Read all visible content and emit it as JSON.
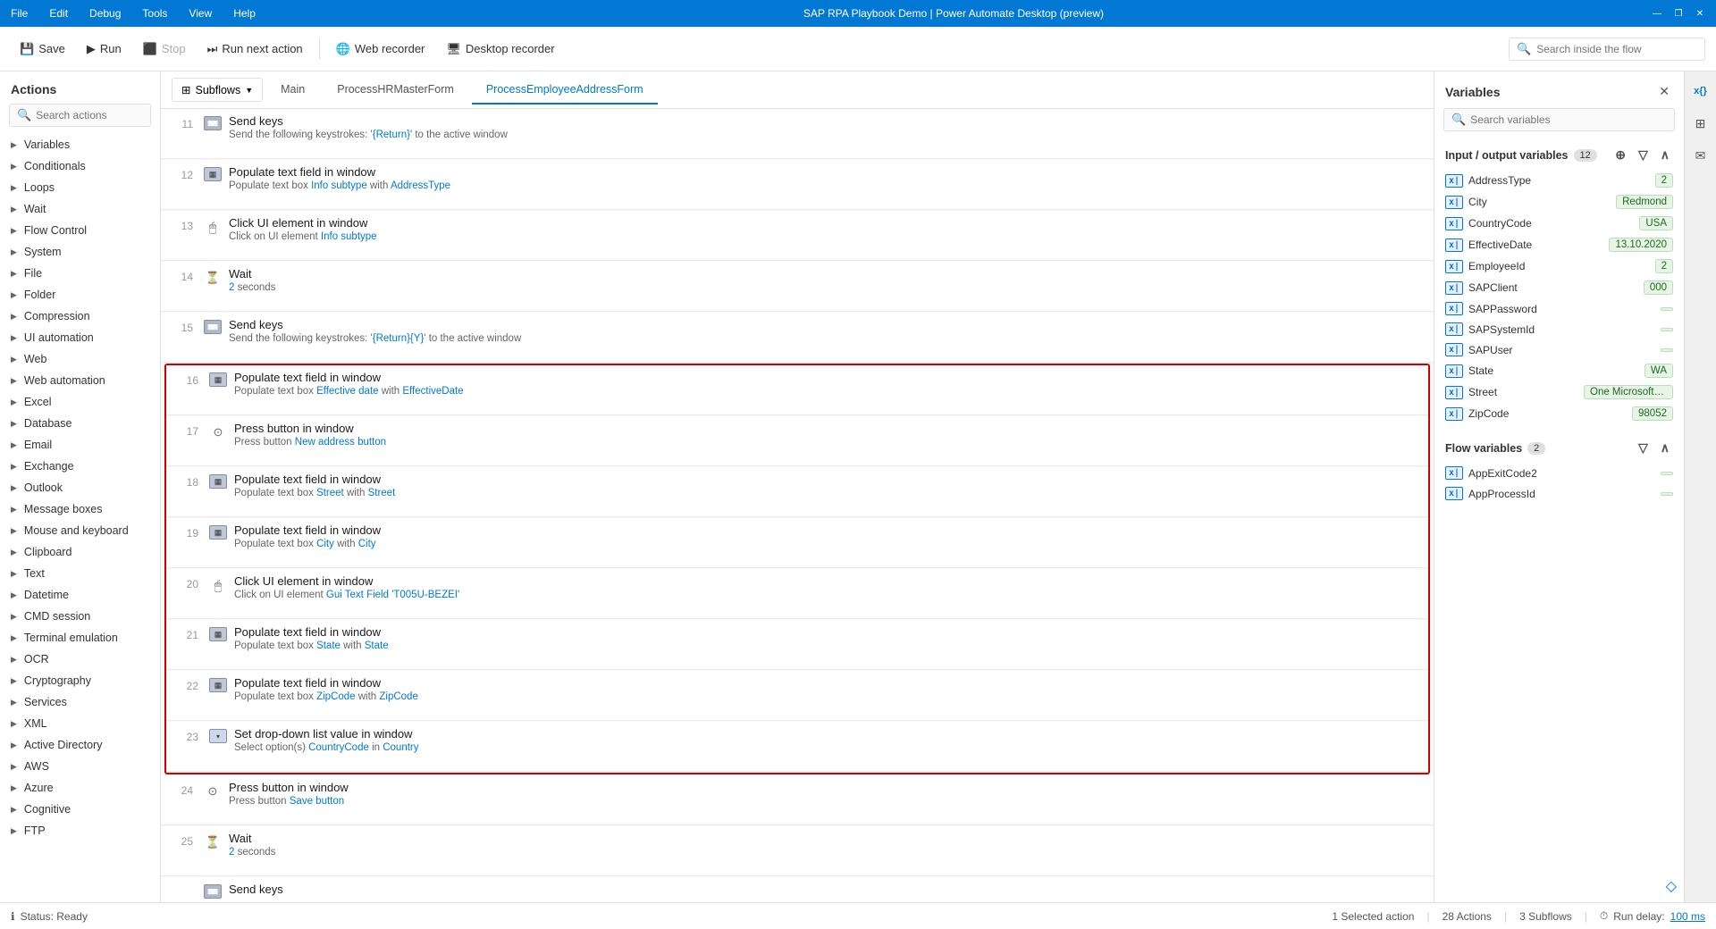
{
  "titleBar": {
    "menus": [
      "File",
      "Edit",
      "Debug",
      "Tools",
      "View",
      "Help"
    ],
    "title": "SAP RPA Playbook Demo | Power Automate Desktop (preview)",
    "windowControls": [
      "—",
      "❐",
      "✕"
    ]
  },
  "toolbar": {
    "saveLabel": "Save",
    "runLabel": "Run",
    "stopLabel": "Stop",
    "runNextLabel": "Run next action",
    "webRecorderLabel": "Web recorder",
    "desktopRecorderLabel": "Desktop recorder",
    "searchPlaceholder": "Search inside the flow"
  },
  "subflows": {
    "buttonLabel": "Subflows",
    "tabs": [
      "Main",
      "ProcessHRMasterForm",
      "ProcessEmployeeAddressForm"
    ]
  },
  "actionsPanel": {
    "title": "Actions",
    "searchPlaceholder": "Search actions",
    "items": [
      "Variables",
      "Conditionals",
      "Loops",
      "Wait",
      "Flow Control",
      "System",
      "File",
      "Folder",
      "Compression",
      "UI automation",
      "Web",
      "Web automation",
      "Excel",
      "Database",
      "Email",
      "Exchange",
      "Outlook",
      "Message boxes",
      "Mouse and keyboard",
      "Clipboard",
      "Text",
      "Datetime",
      "CMD session",
      "Terminal emulation",
      "OCR",
      "Cryptography",
      "Services",
      "XML",
      "Active Directory",
      "AWS",
      "Azure",
      "Cognitive",
      "FTP"
    ]
  },
  "flowRows": [
    {
      "num": 11,
      "type": "keys",
      "title": "Send keys",
      "desc": "Send the following keystrokes: '{Return}' to the active window",
      "descLinks": [],
      "selected": false
    },
    {
      "num": 12,
      "type": "populate",
      "title": "Populate text field in window",
      "desc": "Populate text box Info subtype with  AddressType",
      "descParts": [
        "Populate text box ",
        "Info subtype",
        " with  ",
        "AddressType"
      ],
      "selected": false
    },
    {
      "num": 13,
      "type": "click",
      "title": "Click UI element in window",
      "desc": "Click on UI element Info subtype",
      "descParts": [
        "Click on UI element ",
        "Info subtype"
      ],
      "selected": false
    },
    {
      "num": 14,
      "type": "wait",
      "title": "Wait",
      "desc": "2 seconds",
      "selected": false
    },
    {
      "num": 15,
      "type": "keys",
      "title": "Send keys",
      "desc": "Send the following keystrokes: '{Return}{Y}' to the active window",
      "selected": false
    },
    {
      "num": 16,
      "type": "populate",
      "title": "Populate text field in window",
      "desc": "Populate text box Effective date with  EffectiveDate",
      "descParts": [
        "Populate text box ",
        "Effective date",
        " with  ",
        "EffectiveDate"
      ],
      "selected": true,
      "groupStart": true
    },
    {
      "num": 17,
      "type": "press",
      "title": "Press button in window",
      "desc": "Press button New address button",
      "descParts": [
        "Press button ",
        "New address button"
      ],
      "selected": true
    },
    {
      "num": 18,
      "type": "populate",
      "title": "Populate text field in window",
      "desc": "Populate text box Street with  Street",
      "descParts": [
        "Populate text box ",
        "Street",
        " with  ",
        "Street"
      ],
      "selected": true
    },
    {
      "num": 19,
      "type": "populate",
      "title": "Populate text field in window",
      "desc": "Populate text box City with  City",
      "descParts": [
        "Populate text box ",
        "City",
        " with  ",
        "City"
      ],
      "selected": true
    },
    {
      "num": 20,
      "type": "click",
      "title": "Click UI element in window",
      "desc": "Click on UI element Gui Text Field 'T005U-BEZEI'",
      "descParts": [
        "Click on UI element ",
        "Gui Text Field 'T005U-BEZEI'"
      ],
      "selected": true
    },
    {
      "num": 21,
      "type": "populate",
      "title": "Populate text field in window",
      "desc": "Populate text box State with  State",
      "descParts": [
        "Populate text box ",
        "State",
        " with  ",
        "State"
      ],
      "selected": true
    },
    {
      "num": 22,
      "type": "populate",
      "title": "Populate text field in window",
      "desc": "Populate text box ZipCode with  ZipCode",
      "descParts": [
        "Populate text box ",
        "ZipCode",
        " with  ",
        "ZipCode"
      ],
      "selected": true
    },
    {
      "num": 23,
      "type": "dropdown",
      "title": "Set drop-down list value in window",
      "desc": "Select option(s)  CountryCode  in  Country",
      "descParts": [
        "Select option(s)  ",
        "CountryCode",
        "  in  ",
        "Country"
      ],
      "selected": true,
      "groupEnd": true
    },
    {
      "num": 24,
      "type": "press",
      "title": "Press button in window",
      "desc": "Press button Save button",
      "descParts": [
        "Press button ",
        "Save button"
      ],
      "selected": false
    },
    {
      "num": 25,
      "type": "wait",
      "title": "Wait",
      "desc": "2 seconds",
      "selected": false
    }
  ],
  "variablesPanel": {
    "title": "Variables",
    "searchPlaceholder": "Search variables",
    "inputOutputSection": {
      "label": "Input / output variables",
      "count": "12",
      "variables": [
        {
          "name": "AddressType",
          "value": "2"
        },
        {
          "name": "City",
          "value": "Redmond"
        },
        {
          "name": "CountryCode",
          "value": "USA"
        },
        {
          "name": "EffectiveDate",
          "value": "13.10.2020"
        },
        {
          "name": "EmployeeId",
          "value": "2"
        },
        {
          "name": "SAPClient",
          "value": "000"
        },
        {
          "name": "SAPPassword",
          "value": ""
        },
        {
          "name": "SAPSystemId",
          "value": ""
        },
        {
          "name": "SAPUser",
          "value": ""
        },
        {
          "name": "State",
          "value": "WA"
        },
        {
          "name": "Street",
          "value": "One Microsoft Way"
        },
        {
          "name": "ZipCode",
          "value": "98052"
        }
      ]
    },
    "flowSection": {
      "label": "Flow variables",
      "count": "2",
      "variables": [
        {
          "name": "AppExitCode2",
          "value": ""
        },
        {
          "name": "AppProcessId",
          "value": ""
        }
      ]
    }
  },
  "statusBar": {
    "statusText": "Status: Ready",
    "selectedAction": "1 Selected action",
    "actionsCount": "28 Actions",
    "subflowsCount": "3 Subflows",
    "runDelay": "Run delay:",
    "delayValue": "100 ms"
  }
}
